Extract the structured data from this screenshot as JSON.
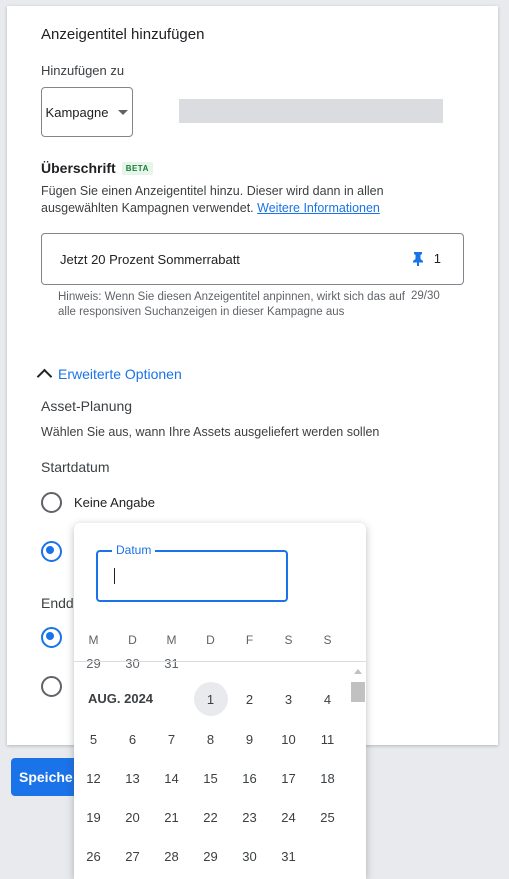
{
  "form": {
    "title": "Anzeigentitel hinzufügen",
    "add_to_label": "Hinzufügen zu",
    "add_to_value": "Kampagne",
    "heading": "Überschrift",
    "beta": "BETA",
    "description": "Fügen Sie einen Anzeigentitel hinzu. Dieser wird dann in allen ausgewählten Kampagnen verwendet.",
    "learn_more": "Weitere Informationen",
    "headline_value": "Jetzt 20 Prozent Sommerrabatt",
    "pin_count": "1",
    "hint": "Hinweis: Wenn Sie diesen Anzeigentitel anpinnen, wirkt sich das auf alle responsiven Suchanzeigen in dieser Kampagne aus",
    "char_counter": "29/30",
    "advanced_options": "Erweiterte Optionen",
    "asset_planning": "Asset-Planung",
    "asset_planning_desc": "Wählen Sie aus, wann Ihre Assets ausgeliefert werden sollen",
    "start_date": "Startdatum",
    "start_option_none": "Keine Angabe",
    "end_date_partial": "Endd",
    "save_partial": "Speiche"
  },
  "datepicker": {
    "field_label": "Datum",
    "weekdays": [
      "M",
      "D",
      "M",
      "D",
      "F",
      "S",
      "S"
    ],
    "prev_partial": [
      "29",
      "30",
      "31"
    ],
    "month": "AUG. 2024",
    "first_row": [
      "1",
      "2",
      "3",
      "4"
    ],
    "rows": [
      [
        "5",
        "6",
        "7",
        "8",
        "9",
        "10",
        "11"
      ],
      [
        "12",
        "13",
        "14",
        "15",
        "16",
        "17",
        "18"
      ],
      [
        "19",
        "20",
        "21",
        "22",
        "23",
        "24",
        "25"
      ],
      [
        "26",
        "27",
        "28",
        "29",
        "30",
        "31"
      ]
    ]
  },
  "colors": {
    "accent": "#1a73e8",
    "beta_green": "#188038"
  }
}
